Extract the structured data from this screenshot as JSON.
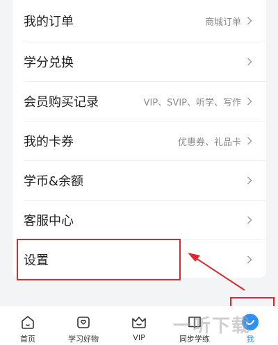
{
  "menu": {
    "items": [
      {
        "label": "我的订单",
        "detail": "商城订单"
      },
      {
        "label": "学分兑换",
        "detail": ""
      },
      {
        "label": "会员购买记录",
        "detail": "VIP、SVIP、听学、写作"
      },
      {
        "label": "我的卡券",
        "detail": "优惠券、礼品卡"
      },
      {
        "label": "学币&余额",
        "detail": ""
      },
      {
        "label": "客服中心",
        "detail": ""
      },
      {
        "label": "设置",
        "detail": ""
      }
    ],
    "chevron_icon": "chevron-right-icon"
  },
  "tabbar": {
    "items": [
      {
        "label": "首页",
        "icon": "home-icon"
      },
      {
        "label": "学习好物",
        "icon": "shopping-bag-icon"
      },
      {
        "label": "VIP",
        "icon": "crown-icon"
      },
      {
        "label": "同步学练",
        "icon": "book-icon"
      },
      {
        "label": "我",
        "icon": "profile-icon",
        "active": true
      }
    ]
  },
  "watermark": "一听下载",
  "colors": {
    "accent": "#2f8ff3",
    "annotation": "#e0262e",
    "background": "#f3f4f6"
  }
}
